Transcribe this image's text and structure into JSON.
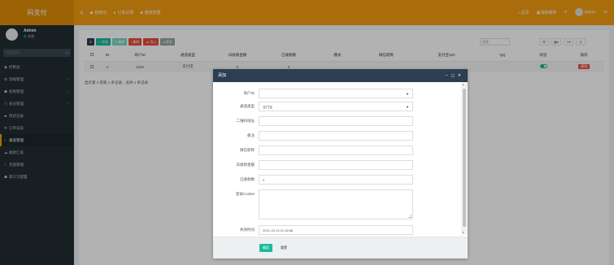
{
  "app": {
    "title": "码支付"
  },
  "topnav": [
    {
      "icon": "dashboard-icon",
      "label": "控制台"
    },
    {
      "icon": "list-icon",
      "label": "订单记录"
    },
    {
      "icon": "card-icon",
      "label": "通道管理"
    }
  ],
  "topright": {
    "home": "主页",
    "clear": "清除缓存",
    "user": "Admin"
  },
  "sidebar": {
    "user_name": "Admin",
    "user_status": "在线",
    "search_placeholder": "搜索菜单",
    "items": [
      {
        "label": "控制台",
        "arrow": false
      },
      {
        "label": "常规管理",
        "arrow": true
      },
      {
        "label": "权限管理",
        "arrow": true
      },
      {
        "label": "会员管理",
        "arrow": true
      },
      {
        "label": "风控记录",
        "arrow": false
      },
      {
        "label": "订单记录",
        "arrow": false
      },
      {
        "label": "通道管理",
        "arrow": false,
        "active": true
      },
      {
        "label": "收款汇总",
        "arrow": false
      },
      {
        "label": "充值管理",
        "arrow": false
      },
      {
        "label": "第三方配置",
        "arrow": false
      }
    ]
  },
  "toolbar": {
    "add": "添加",
    "edit": "编辑",
    "delete": "删除",
    "import": "导入",
    "more": "更多"
  },
  "search_right_placeholder": "搜索",
  "table": {
    "headers": [
      "",
      "ID",
      "商户ID",
      "通道类型",
      "日收款金额",
      "已收款额",
      "模式",
      "微信昵称",
      "支付宝UID",
      "QQ",
      "状态",
      "操作"
    ],
    "rows": [
      {
        "id": "4",
        "merchant": "1000",
        "type": "支付宝",
        "daily": "0",
        "received": "0",
        "mode": "",
        "wx": "",
        "uid": "",
        "qq": "",
        "delete": "删除"
      }
    ]
  },
  "pager_info": "显示第 1 到第 1 条记录，总共 1 条记录",
  "modal": {
    "title": "添加",
    "fields": [
      {
        "label": "商户ID",
        "value": "",
        "type": "select"
      },
      {
        "label": "通道类型",
        "value": "支付宝",
        "type": "select"
      },
      {
        "label": "二维码地址",
        "value": "",
        "type": "input"
      },
      {
        "label": "备注",
        "value": "",
        "type": "input"
      },
      {
        "label": "微信昵称",
        "value": "",
        "type": "input"
      },
      {
        "label": "日收款金额",
        "value": "",
        "type": "input"
      },
      {
        "label": "已收款数",
        "value": "0",
        "type": "input"
      },
      {
        "label": "登录Cookie",
        "value": "",
        "type": "textarea"
      },
      {
        "label": "失效时间",
        "value": "2021-10-13 01:16:68",
        "type": "input"
      }
    ],
    "ok": "确定",
    "reset": "重置"
  },
  "colors": {
    "brand": "#f39c12",
    "sidebar": "#222d32",
    "accent": "#18bc9c",
    "danger": "#e74c3c",
    "header": "#2c3e50"
  }
}
